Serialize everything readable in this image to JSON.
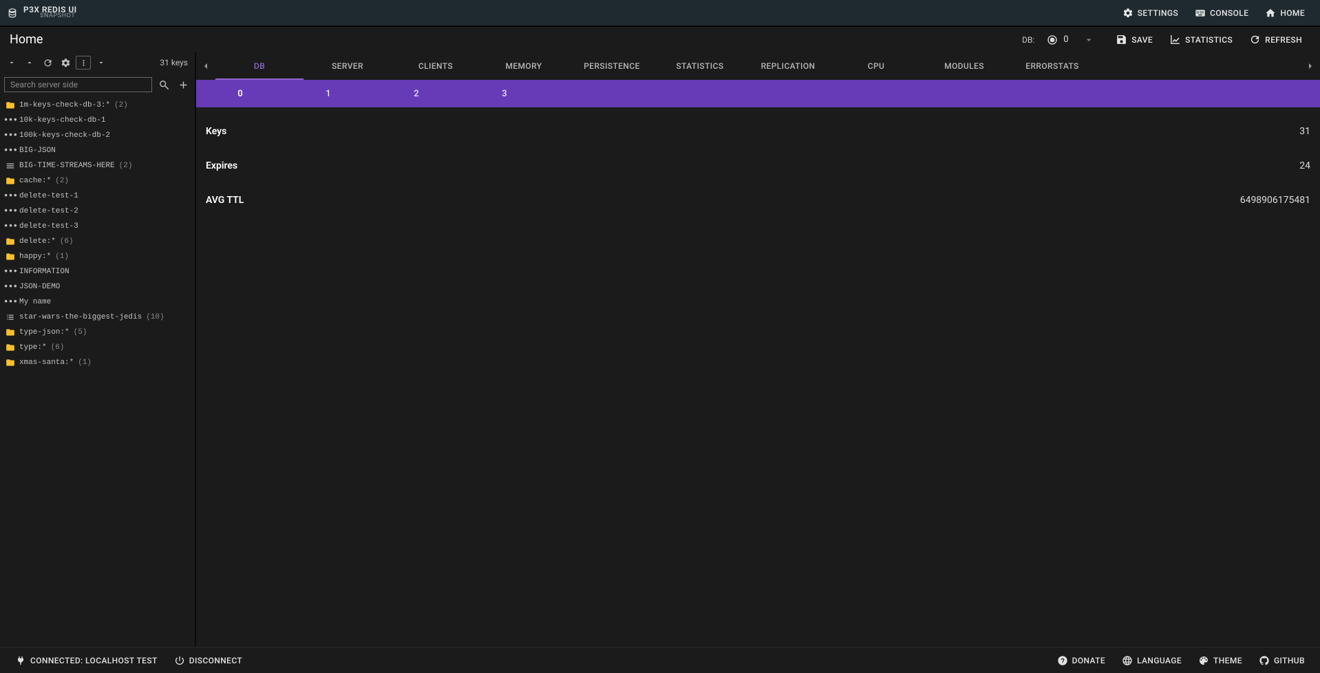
{
  "app": {
    "title": "P3X REDIS UI",
    "subtitle": "SNAPSHOT"
  },
  "topbar": {
    "settings": "SETTINGS",
    "console": "CONSOLE",
    "home": "HOME"
  },
  "subbar": {
    "breadcrumb": "Home",
    "db_label": "DB:",
    "db_value": "0",
    "save": "SAVE",
    "statistics": "STATISTICS",
    "refresh": "REFRESH"
  },
  "sidebar": {
    "key_count": "31 keys",
    "search_placeholder": "Search server side",
    "items": [
      {
        "icon": "folder",
        "name": "1m-keys-check-db-3:*",
        "count": "(2)"
      },
      {
        "icon": "ellipsis",
        "name": "10k-keys-check-db-1",
        "count": ""
      },
      {
        "icon": "ellipsis",
        "name": "100k-keys-check-db-2",
        "count": ""
      },
      {
        "icon": "ellipsis",
        "name": "BIG-JSON",
        "count": ""
      },
      {
        "icon": "stream",
        "name": "BIG-TIME-STREAMS-HERE",
        "count": "(2)"
      },
      {
        "icon": "folder",
        "name": "cache:*",
        "count": "(2)"
      },
      {
        "icon": "ellipsis",
        "name": "delete-test-1",
        "count": ""
      },
      {
        "icon": "ellipsis",
        "name": "delete-test-2",
        "count": ""
      },
      {
        "icon": "ellipsis",
        "name": "delete-test-3",
        "count": ""
      },
      {
        "icon": "folder",
        "name": "delete:*",
        "count": "(6)"
      },
      {
        "icon": "folder",
        "name": "happy:*",
        "count": "(1)"
      },
      {
        "icon": "ellipsis",
        "name": "INFORMATION",
        "count": ""
      },
      {
        "icon": "ellipsis",
        "name": "JSON-DEMO",
        "count": ""
      },
      {
        "icon": "ellipsis",
        "name": "My name",
        "count": ""
      },
      {
        "icon": "list",
        "name": "star-wars-the-biggest-jedis",
        "count": "(10)"
      },
      {
        "icon": "folder",
        "name": "type-json:*",
        "count": "(5)"
      },
      {
        "icon": "folder",
        "name": "type:*",
        "count": "(6)"
      },
      {
        "icon": "folder",
        "name": "xmas-santa:*",
        "count": "(1)"
      }
    ]
  },
  "tabs": [
    "DB",
    "SERVER",
    "CLIENTS",
    "MEMORY",
    "PERSISTENCE",
    "STATISTICS",
    "REPLICATION",
    "CPU",
    "MODULES",
    "ERRORSTATS"
  ],
  "db_chips": [
    "0",
    "1",
    "2",
    "3"
  ],
  "stats": [
    {
      "label": "Keys",
      "value": "31"
    },
    {
      "label": "Expires",
      "value": "24"
    },
    {
      "label": "AVG TTL",
      "value": "6498906175481"
    }
  ],
  "bottom": {
    "connected": "CONNECTED: LOCALHOST TEST",
    "disconnect": "DISCONNECT",
    "donate": "DONATE",
    "language": "LANGUAGE",
    "theme": "THEME",
    "github": "GITHUB"
  }
}
